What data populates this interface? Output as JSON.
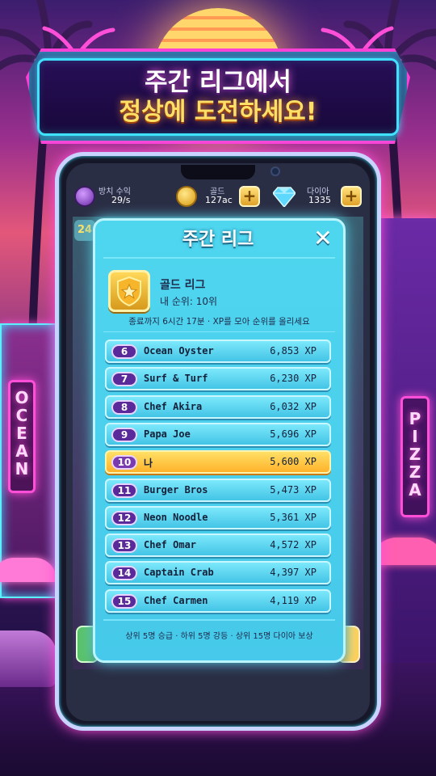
{
  "banner": {
    "line1": "주간 리그에서",
    "line2": "정상에 도전하세요!"
  },
  "hud": {
    "idle_label": "방치 수익",
    "idle_value": "29/s",
    "gold_label": "골드",
    "gold_value": "127ac",
    "diamond_label": "다이아",
    "diamond_value": "1335",
    "plus_label": "+"
  },
  "background_game": {
    "level_badge": "24"
  },
  "modal": {
    "title": "주간 리그",
    "close_label": "✕",
    "league_name": "골드 리그",
    "my_rank": "내 순위: 10위",
    "info": "종료까지 6시간 17분 · XP를 모아 순위를 올리세요",
    "footer": "상위 5명 승급 · 하위 5명 강등 · 상위 15명 다이아 보상"
  },
  "leaderboard": [
    {
      "rank": "6",
      "name": "Ocean Oyster",
      "xp": "6,853 XP",
      "is_me": false
    },
    {
      "rank": "7",
      "name": "Surf & Turf",
      "xp": "6,230 XP",
      "is_me": false
    },
    {
      "rank": "8",
      "name": "Chef Akira",
      "xp": "6,032 XP",
      "is_me": false
    },
    {
      "rank": "9",
      "name": "Papa Joe",
      "xp": "5,696 XP",
      "is_me": false
    },
    {
      "rank": "10",
      "name": "나",
      "xp": "5,600 XP",
      "is_me": true
    },
    {
      "rank": "11",
      "name": "Burger Bros",
      "xp": "5,473 XP",
      "is_me": false
    },
    {
      "rank": "12",
      "name": "Neon Noodle",
      "xp": "5,361 XP",
      "is_me": false
    },
    {
      "rank": "13",
      "name": "Chef Omar",
      "xp": "4,572 XP",
      "is_me": false
    },
    {
      "rank": "14",
      "name": "Captain Crab",
      "xp": "4,397 XP",
      "is_me": false
    },
    {
      "rank": "15",
      "name": "Chef Carmen",
      "xp": "4,119 XP",
      "is_me": false
    }
  ],
  "scenery": {
    "sign_left": "OCEAN",
    "sign_right": "PIZZA"
  },
  "colors": {
    "neon_pink": "#ff3fd6",
    "neon_cyan": "#3fe3ff",
    "highlight_row": "#ffc23a",
    "modal_bg": "#4fd6ef"
  }
}
